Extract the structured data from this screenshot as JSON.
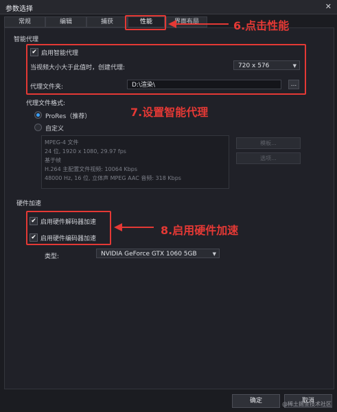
{
  "window": {
    "title": "参数选择",
    "close_glyph": "✕"
  },
  "tabs": [
    {
      "label": "常规"
    },
    {
      "label": "编辑"
    },
    {
      "label": "捕获"
    },
    {
      "label": "性能"
    },
    {
      "label": "界面布局"
    }
  ],
  "smart_proxy": {
    "heading": "智能代理",
    "enable_label": "启用智能代理",
    "enable_checked_glyph": "✔",
    "threshold_label": "当视频大小大于此值时，创建代理:",
    "threshold_value": "720 x 576",
    "folder_label": "代理文件夹:",
    "folder_value": "D:\\渲染\\",
    "browse_label": "..."
  },
  "proxy_format": {
    "heading": "代理文件格式:",
    "options": [
      {
        "label": "ProRes（推荐）",
        "selected": true
      },
      {
        "label": "自定义",
        "selected": false
      }
    ],
    "info_lines": [
      "MPEG-4 文件",
      "24 位, 1920 x 1080, 29.97 fps",
      "基于帧",
      "H.264 主配置文件视频: 10064 Kbps",
      "48000 Hz, 16 位, 立体声 MPEG AAC 音频: 318 Kbps"
    ],
    "buttons": [
      "模板...",
      "选项..."
    ]
  },
  "hardware": {
    "heading": "硬件加速",
    "decoder_label": "启用硬件解码器加速",
    "encoder_label": "启用硬件编码器加速",
    "checked_glyph": "✔",
    "type_label": "类型:",
    "type_value": "NVIDIA GeForce GTX 1060 5GB"
  },
  "annotations": {
    "note1": "6.点击性能",
    "note2": "7.设置智能代理",
    "note3": "8.启用硬件加速",
    "color": "#e53935"
  },
  "footer": {
    "ok_label": "确定",
    "cancel_label": "取消"
  },
  "watermark": "@稀土掘金技术社区"
}
